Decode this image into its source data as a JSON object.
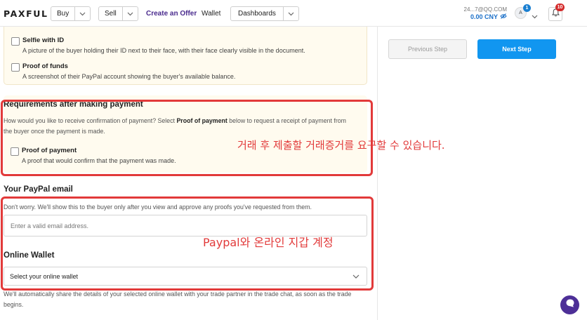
{
  "header": {
    "logo": "PAXFUL",
    "buy_label": "Buy",
    "sell_label": "Sell",
    "create_offer_label": "Create an Offer",
    "wallet_label": "Wallet",
    "dashboards_label": "Dashboards",
    "account_id": "24...7@QQ.COM",
    "balance": "0.00 CNY",
    "avatar_initial": "A",
    "avatar_badge": "1",
    "notifications_count": "10"
  },
  "proofs": {
    "selfie_title": "Selfie with ID",
    "selfie_desc": "A picture of the buyer holding their ID next to their face, with their face clearly visible in the document.",
    "funds_title": "Proof of funds",
    "funds_desc": "A screenshot of their PayPal account showing the buyer's available balance."
  },
  "requirements": {
    "title": "Requirements after making payment",
    "desc_line1_a": "How would you like to receive confirmation of payment? Select ",
    "desc_line1_bold": "Proof of payment",
    "desc_line1_b": " below to request a receipt of payment from",
    "desc_line2": "the buyer once the payment is made.",
    "pop_title": "Proof of payment",
    "pop_desc": "A proof that would confirm that the payment was made."
  },
  "paypal": {
    "title": "Your PayPal email",
    "desc": "Don't worry. We'll show this to the buyer only after you view and approve any proofs you've requested from them.",
    "email_placeholder": "Enter a valid email address.",
    "email_value": ""
  },
  "online_wallet": {
    "title": "Online Wallet",
    "selected": "Select your online wallet",
    "note_line1": "We'll automatically share the details of your selected online wallet with your trade partner in the trade chat, as soon as the trade",
    "note_line2": "begins."
  },
  "annotations": {
    "requirements_note": "거래 후 제출할 거래증거를 요구할 수 있습니다.",
    "paypal_note": "Paypal와 온라인 지갑 계정",
    "color": "#e23a3a"
  },
  "steps": {
    "previous_label": "Previous Step",
    "next_label": "Next Step"
  },
  "colors": {
    "accent_blue": "#1196f0",
    "brand_purple": "#4d2f97",
    "card_bg": "#fffbef",
    "badge_red": "#d42b2b"
  }
}
